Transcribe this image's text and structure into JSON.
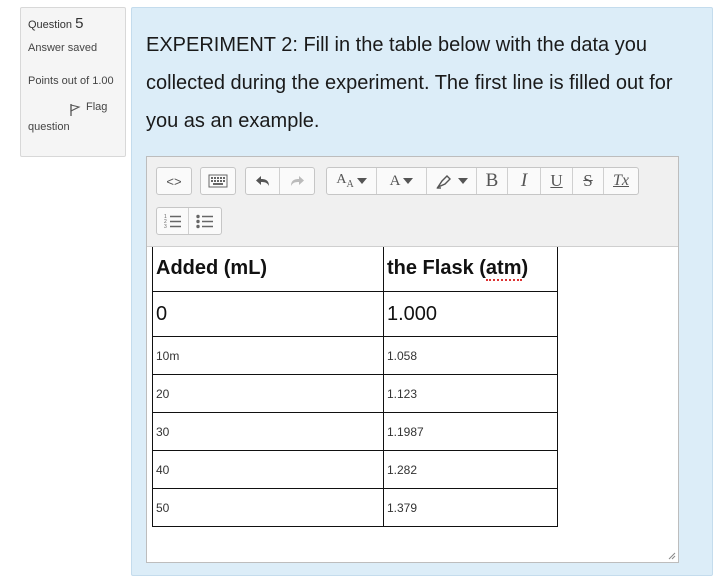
{
  "info": {
    "question_label": "Question",
    "question_number": "5",
    "status": "Answer saved",
    "points": "Points out of 1.00",
    "flag_label": "Flag",
    "flag_label_2": "question"
  },
  "question": {
    "text": "EXPERIMENT 2: Fill in the table below with the data you collected during the experiment. The first line is filled out for you as an example."
  },
  "toolbar": {
    "code_icon": "<>",
    "bold": "B",
    "italic": "I",
    "underline": "U",
    "strike": "S",
    "clear_format": "Tx",
    "font_size": "A",
    "font_color": "A"
  },
  "table": {
    "headers": [
      "Added (mL)",
      "the Flask (atm)"
    ],
    "rows": [
      [
        "0",
        "1.000"
      ],
      [
        "10m",
        "1.058"
      ],
      [
        "20",
        "1.123"
      ],
      [
        "30",
        "1.1987"
      ],
      [
        "40",
        "1.282"
      ],
      [
        "50",
        "1.379"
      ]
    ]
  },
  "colors": {
    "panel_bg": "#dcedf8",
    "info_bg": "#f5f5f5"
  }
}
